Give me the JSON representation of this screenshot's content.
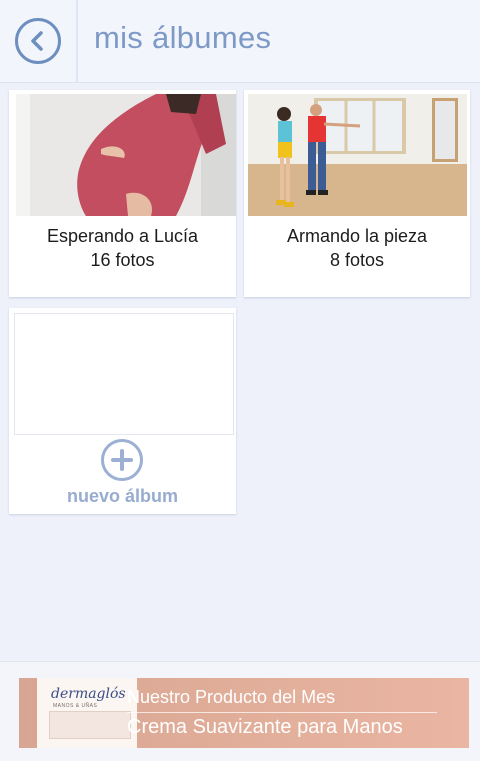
{
  "header": {
    "title": "mis álbumes"
  },
  "albums": [
    {
      "name": "Esperando a Lucía",
      "count": "16 fotos"
    },
    {
      "name": "Armando la pieza",
      "count": "8 fotos"
    }
  ],
  "new_album": {
    "label": "nuevo álbum"
  },
  "ad": {
    "brand": "dermaglós",
    "brand_sub": "MANOS & UÑAS",
    "line1": "Nuestro Producto del Mes",
    "line2": "Crema Suavizante para Manos"
  }
}
